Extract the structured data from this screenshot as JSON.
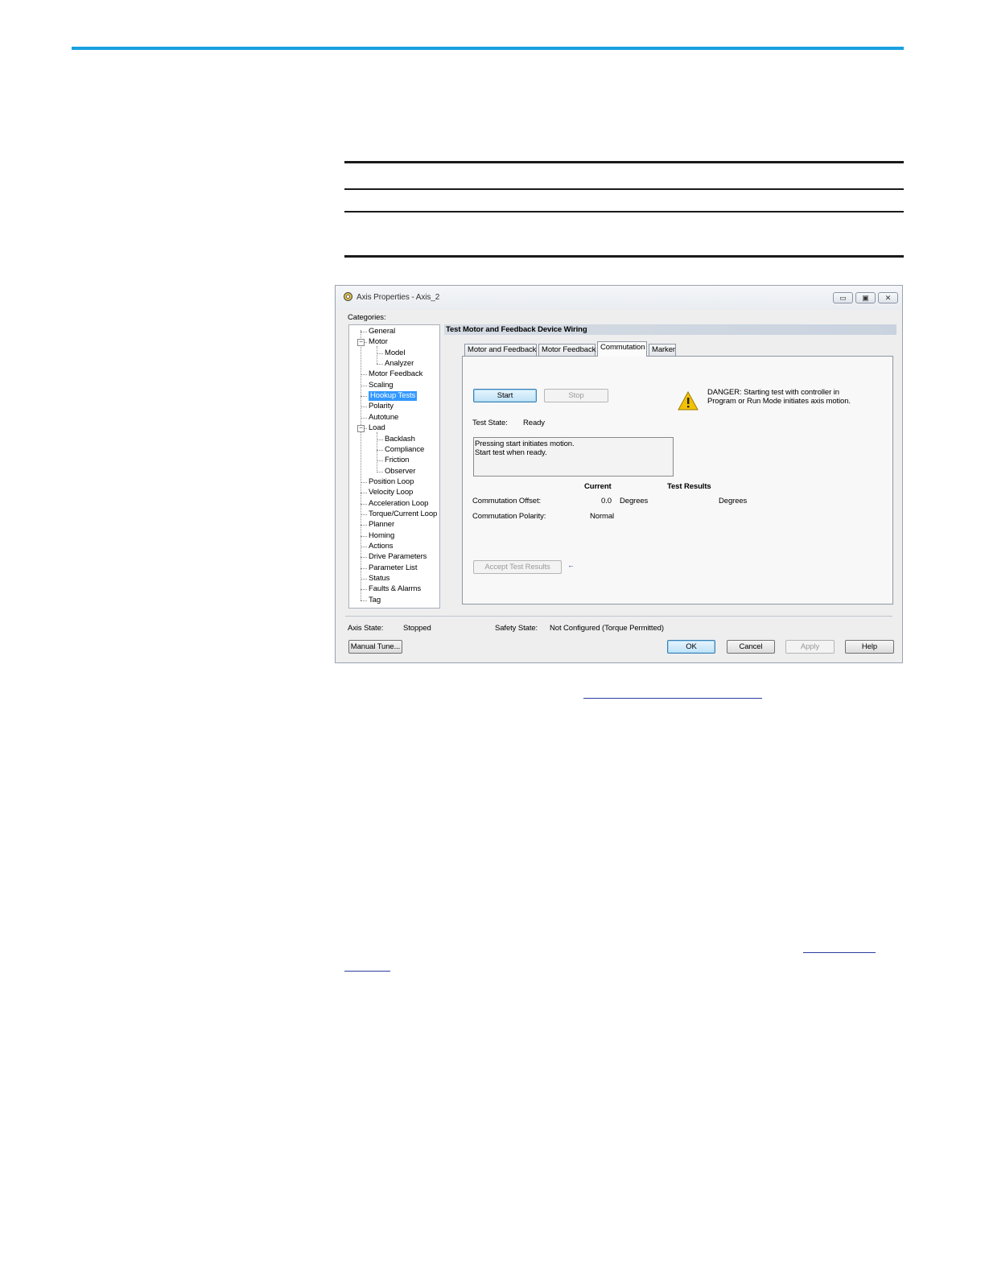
{
  "window": {
    "title": "Axis Properties - Axis_2",
    "minimize": "▭",
    "restore": "▣",
    "close": "✕",
    "categories_label": "Categories:"
  },
  "tree": [
    {
      "label": "General"
    },
    {
      "label": "Motor"
    },
    {
      "label": "Model"
    },
    {
      "label": "Analyzer"
    },
    {
      "label": "Motor Feedback"
    },
    {
      "label": "Scaling"
    },
    {
      "label": "Hookup Tests"
    },
    {
      "label": "Polarity"
    },
    {
      "label": "Autotune"
    },
    {
      "label": "Load"
    },
    {
      "label": "Backlash"
    },
    {
      "label": "Compliance"
    },
    {
      "label": "Friction"
    },
    {
      "label": "Observer"
    },
    {
      "label": "Position Loop"
    },
    {
      "label": "Velocity Loop"
    },
    {
      "label": "Acceleration Loop"
    },
    {
      "label": "Torque/Current Loop"
    },
    {
      "label": "Planner"
    },
    {
      "label": "Homing"
    },
    {
      "label": "Actions"
    },
    {
      "label": "Drive Parameters"
    },
    {
      "label": "Parameter List"
    },
    {
      "label": "Status"
    },
    {
      "label": "Faults & Alarms"
    },
    {
      "label": "Tag"
    }
  ],
  "selected_category": "Hookup Tests",
  "section_title": "Test Motor and Feedback Device Wiring",
  "tabs": [
    "Motor and Feedback",
    "Motor Feedback",
    "Commutation",
    "Marker"
  ],
  "active_tab": "Commutation",
  "panel": {
    "start_label": "Start",
    "stop_label": "Stop",
    "danger_text": "DANGER: Starting test with controller in Program or Run Mode initiates axis motion.",
    "test_state_label": "Test State:",
    "test_state_value": "Ready",
    "message": "Pressing start initiates motion.\nStart test when ready.",
    "col_current": "Current",
    "col_test_results": "Test Results",
    "offset_label": "Commutation Offset:",
    "offset_current": "0.0",
    "offset_unit": "Degrees",
    "offset_result_unit": "Degrees",
    "polarity_label": "Commutation Polarity:",
    "polarity_current": "Normal",
    "accept_label": "Accept Test Results",
    "accept_arrow": "←"
  },
  "footer": {
    "axis_state_label": "Axis State:",
    "axis_state_value": "Stopped",
    "safety_state_label": "Safety State:",
    "safety_state_value": "Not Configured (Torque Permitted)",
    "manual_tune": "Manual Tune...",
    "ok": "OK",
    "cancel": "Cancel",
    "apply": "Apply",
    "help": "Help"
  },
  "colors": {
    "accent_bar": "#1aa0e0",
    "selection": "#3399ff",
    "danger_icon": "#f2c200"
  }
}
